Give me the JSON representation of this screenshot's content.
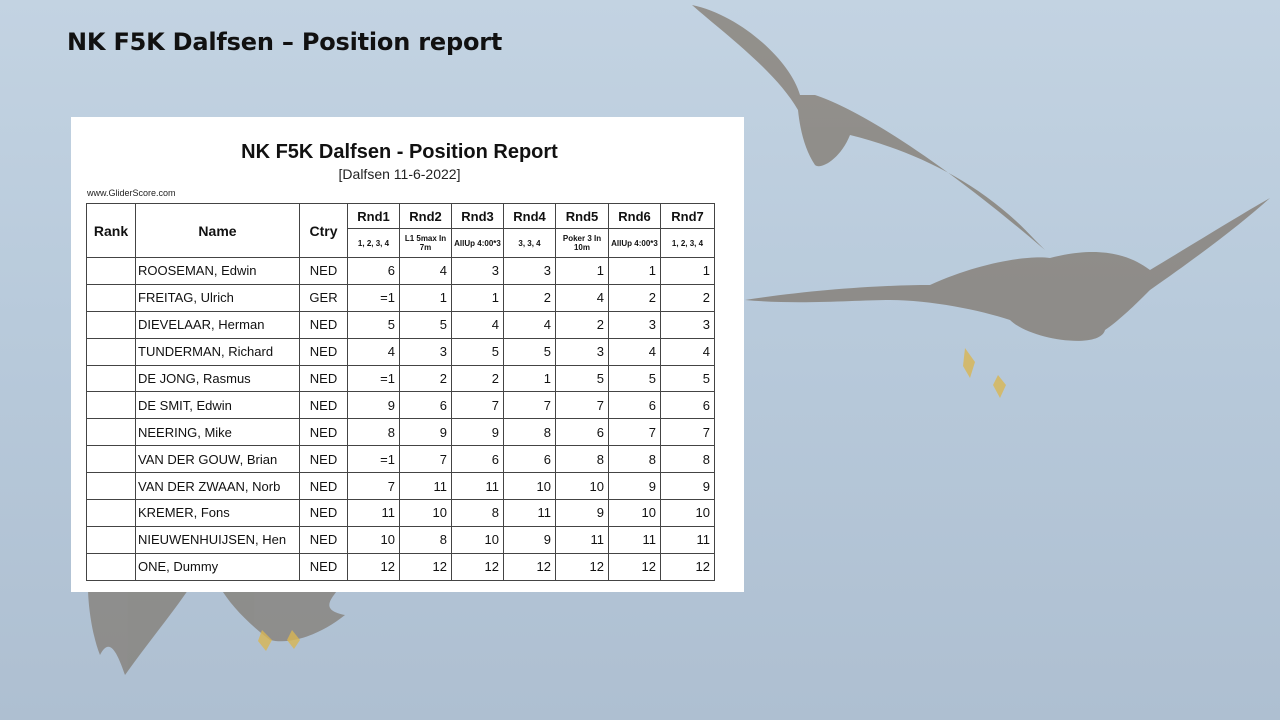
{
  "slide_title": "NK F5K Dalfsen – Position report",
  "report": {
    "title": "NK F5K Dalfsen - Position Report",
    "subtitle": "[Dalfsen 11-6-2022]",
    "website": "www.GliderScore.com",
    "headers": {
      "rank": "Rank",
      "name": "Name",
      "ctry": "Ctry"
    },
    "rounds": [
      {
        "label": "Rnd1",
        "sub": "1, 2, 3, 4"
      },
      {
        "label": "Rnd2",
        "sub": "L1 5max In 7m"
      },
      {
        "label": "Rnd3",
        "sub": "AllUp 4:00*3"
      },
      {
        "label": "Rnd4",
        "sub": "3, 3, 4"
      },
      {
        "label": "Rnd5",
        "sub": "Poker 3 In 10m"
      },
      {
        "label": "Rnd6",
        "sub": "AllUp 4:00*3"
      },
      {
        "label": "Rnd7",
        "sub": "1, 2, 3, 4"
      }
    ],
    "rows": [
      {
        "rank": "",
        "name": "ROOSEMAN, Edwin",
        "ctry": "NED",
        "positions": [
          "6",
          "4",
          "3",
          "3",
          "1",
          "1",
          "1"
        ]
      },
      {
        "rank": "",
        "name": "FREITAG, Ulrich",
        "ctry": "GER",
        "positions": [
          "=1",
          "1",
          "1",
          "2",
          "4",
          "2",
          "2"
        ]
      },
      {
        "rank": "",
        "name": "DIEVELAAR, Herman",
        "ctry": "NED",
        "positions": [
          "5",
          "5",
          "4",
          "4",
          "2",
          "3",
          "3"
        ]
      },
      {
        "rank": "",
        "name": "TUNDERMAN, Richard",
        "ctry": "NED",
        "positions": [
          "4",
          "3",
          "5",
          "5",
          "3",
          "4",
          "4"
        ]
      },
      {
        "rank": "",
        "name": "DE JONG, Rasmus",
        "ctry": "NED",
        "positions": [
          "=1",
          "2",
          "2",
          "1",
          "5",
          "5",
          "5"
        ]
      },
      {
        "rank": "",
        "name": "DE SMIT, Edwin",
        "ctry": "NED",
        "positions": [
          "9",
          "6",
          "7",
          "7",
          "7",
          "6",
          "6"
        ]
      },
      {
        "rank": "",
        "name": "NEERING, Mike",
        "ctry": "NED",
        "positions": [
          "8",
          "9",
          "9",
          "8",
          "6",
          "7",
          "7"
        ]
      },
      {
        "rank": "",
        "name": "VAN DER GOUW, Brian",
        "ctry": "NED",
        "positions": [
          "=1",
          "7",
          "6",
          "6",
          "8",
          "8",
          "8"
        ]
      },
      {
        "rank": "",
        "name": "VAN DER ZWAAN, Norb",
        "ctry": "NED",
        "positions": [
          "7",
          "11",
          "11",
          "10",
          "10",
          "9",
          "9"
        ]
      },
      {
        "rank": "",
        "name": "KREMER, Fons",
        "ctry": "NED",
        "positions": [
          "11",
          "10",
          "8",
          "11",
          "9",
          "10",
          "10"
        ]
      },
      {
        "rank": "",
        "name": "NIEUWENHUIJSEN, Hen",
        "ctry": "NED",
        "positions": [
          "10",
          "8",
          "10",
          "9",
          "11",
          "11",
          "11"
        ]
      },
      {
        "rank": "",
        "name": "ONE, Dummy",
        "ctry": "NED",
        "positions": [
          "12",
          "12",
          "12",
          "12",
          "12",
          "12",
          "12"
        ]
      }
    ]
  }
}
